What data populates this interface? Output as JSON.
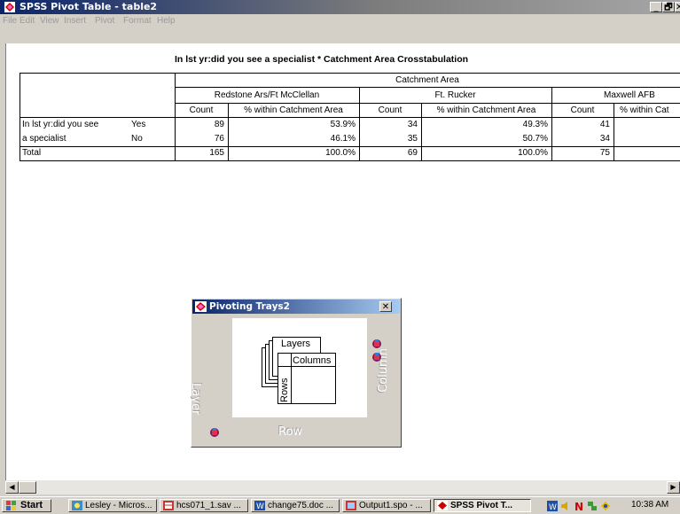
{
  "window": {
    "title": "SPSS Pivot Table - table2",
    "minimize_label": "_",
    "restore_label": "🗗",
    "close_label": "✕"
  },
  "menu": [
    "File",
    "Edit",
    "View",
    "Insert",
    "Pivot",
    "Format",
    "Help"
  ],
  "table": {
    "title": "In lst yr:did you see a specialist * Catchment Area Crosstabulation",
    "group_header": "Catchment Area",
    "areas": [
      "Redstone Ars/Ft McClellan",
      "Ft. Rucker",
      "Maxwell AFB"
    ],
    "col_count": "Count",
    "col_pct": "% within Catchment Area",
    "col_pct_cut": "% within Cat",
    "row_var_line1": "In lst yr:did you see",
    "row_var_line2": "a specialist",
    "row_yes": "Yes",
    "row_no": "No",
    "row_total": "Total",
    "rows": [
      {
        "c1": "89",
        "p1": "53.9%",
        "c2": "34",
        "p2": "49.3%",
        "c3": "41"
      },
      {
        "c1": "76",
        "p1": "46.1%",
        "c2": "35",
        "p2": "50.7%",
        "c3": "34"
      },
      {
        "c1": "165",
        "p1": "100.0%",
        "c2": "69",
        "p2": "100.0%",
        "c3": "75"
      }
    ]
  },
  "pivot_dialog": {
    "title": "Pivoting Trays2",
    "close_label": "✕",
    "layer_tray": "Layer",
    "column_tray": "Column",
    "row_tray": "Row",
    "diagram_layers": "Layers",
    "diagram_columns": "Columns",
    "diagram_rows": "Rows"
  },
  "taskbar": {
    "start": "Start",
    "items": [
      "Lesley - Micros...",
      "hcs071_1.sav ...",
      "change75.doc ...",
      "Output1.spo - ...",
      "SPSS Pivot T..."
    ],
    "clock": "10:38 AM"
  },
  "colors": {
    "title_bar": "#0a246a",
    "window_face": "#d4d0c8",
    "canvas": "#ffffff"
  }
}
